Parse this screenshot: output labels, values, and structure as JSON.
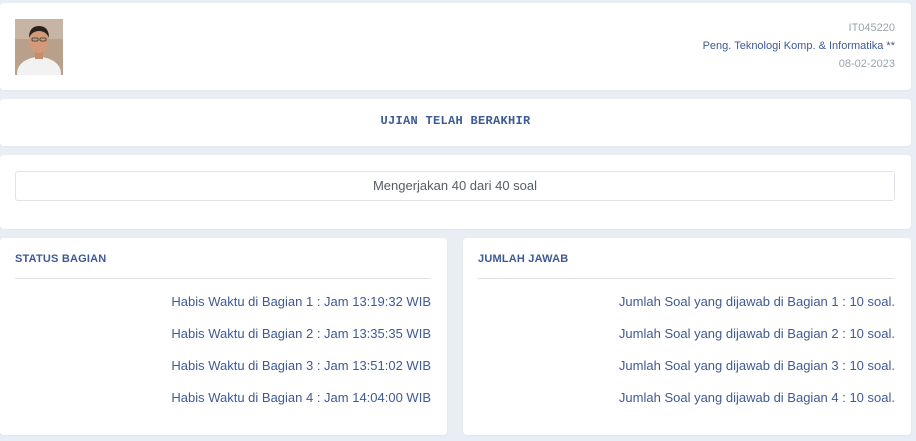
{
  "header": {
    "user_id": "IT045220",
    "program": "Peng. Teknologi Komp. & Informatika **",
    "date": "08-02-2023"
  },
  "status": {
    "text": "UJIAN TELAH BERAKHIR"
  },
  "progress": {
    "text": "Mengerjakan 40 dari 40 soal"
  },
  "section_status": {
    "title": "STATUS BAGIAN",
    "rows": [
      "Habis Waktu di Bagian 1 : Jam 13:19:32 WIB",
      "Habis Waktu di Bagian 2 : Jam 13:35:35 WIB",
      "Habis Waktu di Bagian 3 : Jam 13:51:02 WIB",
      "Habis Waktu di Bagian 4 : Jam 14:04:00 WIB"
    ]
  },
  "answer_count": {
    "title": "JUMLAH JAWAB",
    "rows": [
      "Jumlah Soal yang dijawab di Bagian 1 : 10 soal.",
      "Jumlah Soal yang dijawab di Bagian 2 : 10 soal.",
      "Jumlah Soal yang dijawab di Bagian 3 : 10 soal.",
      "Jumlah Soal yang dijawab di Bagian 4 : 10 soal."
    ]
  },
  "colors": {
    "accent": "#3d5a96",
    "muted": "#9aa3ad",
    "background": "#e9eef5",
    "card": "#ffffff"
  }
}
